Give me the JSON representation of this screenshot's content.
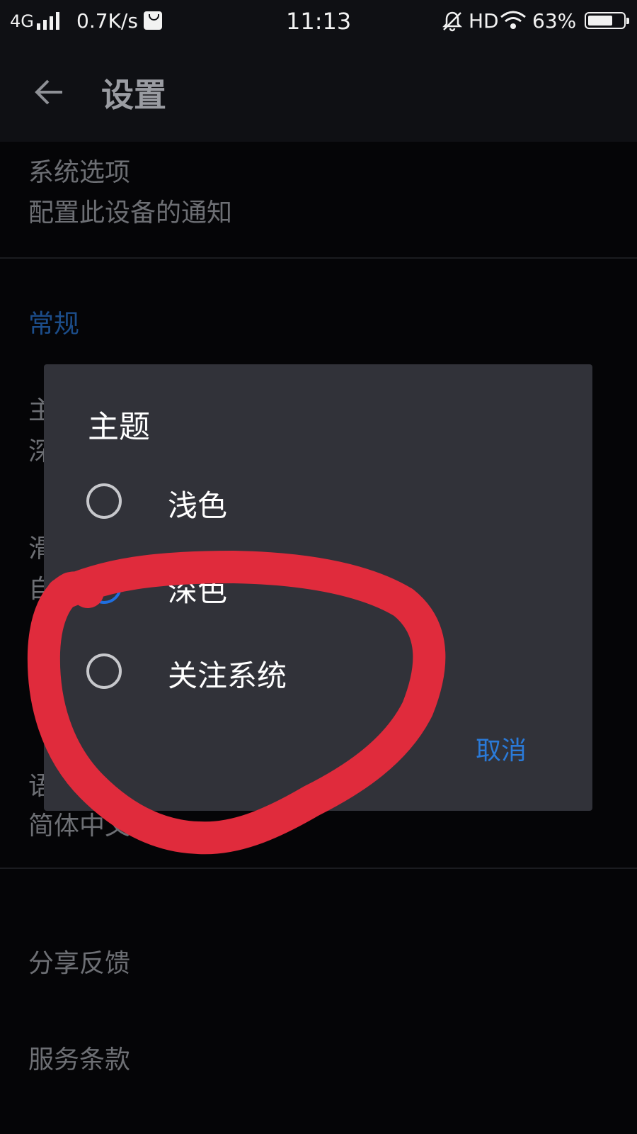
{
  "status_bar": {
    "network": "4G",
    "speed": "0.7K/s",
    "time": "11:13",
    "hd": "HD",
    "battery": "63%",
    "battery_level": 0.63
  },
  "app_bar": {
    "title": "设置",
    "back_icon": "arrow-left-icon"
  },
  "settings": {
    "system_options_title": "系统选项",
    "system_options_subtitle": "配置此设备的通知",
    "general_header": "常规",
    "theme_title_partial": "主",
    "theme_value_partial": "深",
    "swipe_title_partial": "滑",
    "swipe_value_partial": "自",
    "language_title_partial": "语",
    "language_value_partial": "简体中文",
    "share_feedback": "分享反馈",
    "terms": "服务条款"
  },
  "dialog": {
    "title": "主题",
    "options": [
      {
        "label": "浅色",
        "selected": false
      },
      {
        "label": "深色",
        "selected": true
      },
      {
        "label": "关注系统",
        "selected": false
      }
    ],
    "cancel": "取消"
  },
  "colors": {
    "accent": "#1f6fe0",
    "annotation": "#e02b3c",
    "dialog_bg": "#313239"
  }
}
